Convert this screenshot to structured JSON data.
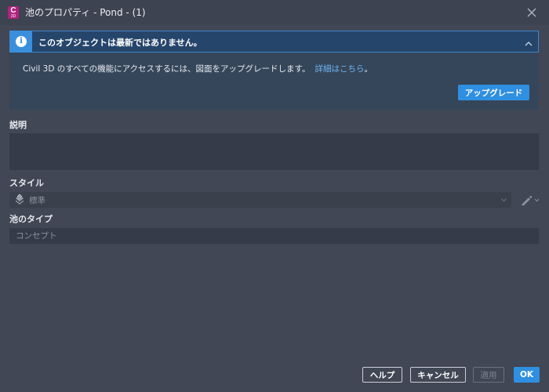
{
  "window": {
    "title": "池のプロパティ - Pond - (1)",
    "app_icon_letter": "C",
    "app_icon_sub": "3D"
  },
  "banner": {
    "title": "このオブジェクトは最新ではありません。",
    "message": "Civil 3D のすべての機能にアクセスするには、図面をアップグレードします。",
    "link_text": "詳細はこちら",
    "link_suffix": "。",
    "upgrade_button": "アップグレード",
    "info_glyph": "i"
  },
  "description": {
    "label": "説明",
    "value": ""
  },
  "style": {
    "label": "スタイル",
    "selected": "標準",
    "icon": "style-swatch-icon",
    "edit_icon": "pen-icon"
  },
  "pond_type": {
    "label": "池のタイプ",
    "placeholder": "コンセプト"
  },
  "footer": {
    "help": "ヘルプ",
    "cancel": "キャンセル",
    "apply": "適用",
    "ok": "OK"
  },
  "colors": {
    "accent": "#2f8fe0",
    "app_icon": "#b0227d",
    "banner_border": "#3f86c9",
    "link": "#6fb6f2"
  }
}
